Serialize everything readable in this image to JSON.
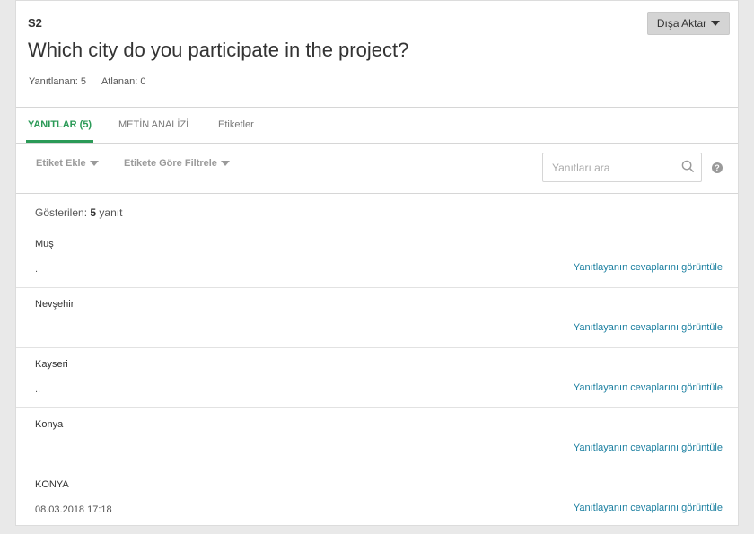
{
  "question": {
    "number": "S2",
    "title": "Which city do you participate in the project?",
    "answered_label": "Yanıtlanan:",
    "answered_count": "5",
    "skipped_label": "Atlanan:",
    "skipped_count": "0"
  },
  "export_button": {
    "label": "Dışa Aktar"
  },
  "tabs": [
    {
      "label": "YANITLAR (5)",
      "active": true
    },
    {
      "label": "METİN ANALİZİ",
      "active": false
    },
    {
      "label": "Etiketler",
      "active": false
    }
  ],
  "filters": {
    "add_tag": "Etiket Ekle",
    "filter_by_tag": "Etikete Göre Filtrele",
    "search_placeholder": "Yanıtları ara",
    "help": "?"
  },
  "showing": {
    "prefix": "Gösterilen:",
    "count": "5",
    "suffix": "yanıt"
  },
  "responses": [
    {
      "answer": "Muş",
      "meta": ".",
      "link": "Yanıtlayanın cevaplarını görüntüle"
    },
    {
      "answer": "Nevşehir",
      "meta": "",
      "link": "Yanıtlayanın cevaplarını görüntüle"
    },
    {
      "answer": "Kayseri",
      "meta": "..",
      "link": "Yanıtlayanın cevaplarını görüntüle"
    },
    {
      "answer": "Konya",
      "meta": "",
      "link": "Yanıtlayanın cevaplarını görüntüle"
    },
    {
      "answer": "KONYA",
      "meta": "08.03.2018 17:18",
      "link": "Yanıtlayanın cevaplarını görüntüle"
    }
  ],
  "colors": {
    "accent_green": "#2b9a57",
    "link_blue": "#1b7fa0"
  },
  "icons": {
    "search": "search-icon",
    "help": "help-icon",
    "dropdown": "caret-down-icon"
  }
}
